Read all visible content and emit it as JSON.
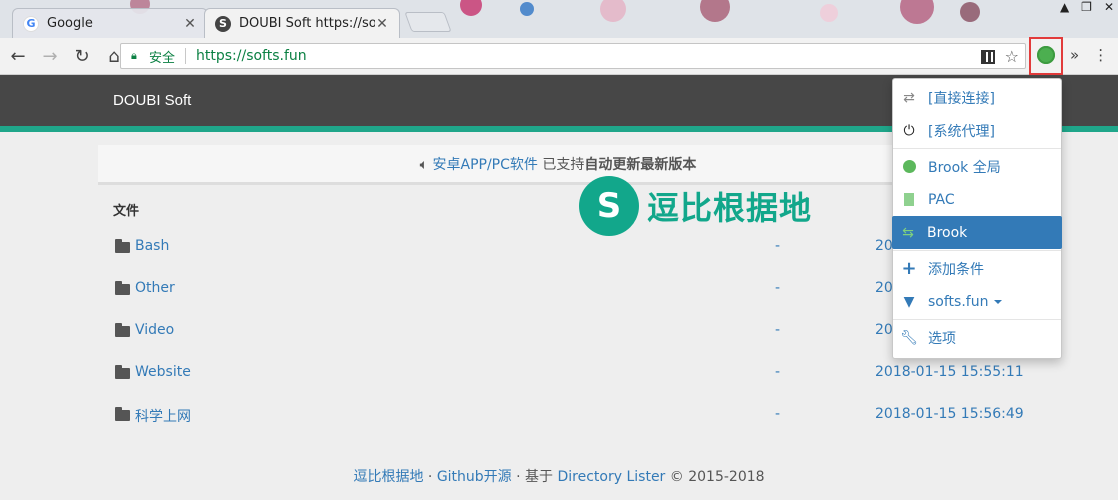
{
  "browser": {
    "tabs": [
      {
        "title": "Google",
        "favicon": "google-g-icon"
      },
      {
        "title": "DOUBI Soft https://soft",
        "favicon": "doubi-soft-icon"
      }
    ],
    "security_label": "安全",
    "url": "https://softs.fun",
    "icons": {
      "back": "back-arrow-icon",
      "forward": "forward-arrow-icon",
      "reload": "reload-icon",
      "home": "home-icon",
      "qr": "qr-code-icon",
      "star": "bookmark-star-icon",
      "extension": "proxy-extension-icon",
      "overflow": "chevron-double-down-icon",
      "menu": "kebab-menu-icon"
    },
    "extension_status_color": "#4caf50"
  },
  "site": {
    "brand": "DOUBI Soft",
    "accent_color": "#1fa68a",
    "notice": {
      "prefix_icon": "speaker-icon",
      "link": "安卓APP/PC软件",
      "middle": " 已支持",
      "bold": "自动更新最新版本"
    },
    "file_header": "文件",
    "rows": [
      {
        "name": "Bash",
        "size": "-",
        "date": "20"
      },
      {
        "name": "Other",
        "size": "-",
        "date": "20"
      },
      {
        "name": "Video",
        "size": "-",
        "date": "20"
      },
      {
        "name": "Website",
        "size": "-",
        "date": "2018-01-15 15:55:11"
      },
      {
        "name": "科学上网",
        "size": "-",
        "date": "2018-01-15 15:56:49"
      }
    ],
    "footer": {
      "site_link": "逗比根据地",
      "dot1": " · ",
      "github_link": "Github开源",
      "dot2": " · 基于 ",
      "lister_link": "Directory Lister",
      "copyright": " © 2015-2018"
    },
    "watermark": {
      "logo_glyph": "S",
      "text": "逗比根据地"
    }
  },
  "proxy_menu": {
    "items": [
      {
        "label": "[直接连接]",
        "icon": "exchange-arrows-icon"
      },
      {
        "label": "[系统代理]",
        "icon": "power-icon"
      },
      {
        "label": "Brook 全局",
        "icon": "globe-icon"
      },
      {
        "label": "PAC",
        "icon": "file-icon"
      },
      {
        "label": "Brook",
        "icon": "retweet-icon",
        "active": true
      },
      {
        "label": "添加条件",
        "icon": "plus-icon"
      },
      {
        "label": "softs.fun",
        "icon": "filter-icon"
      },
      {
        "label": "选项",
        "icon": "wrench-icon"
      }
    ]
  }
}
